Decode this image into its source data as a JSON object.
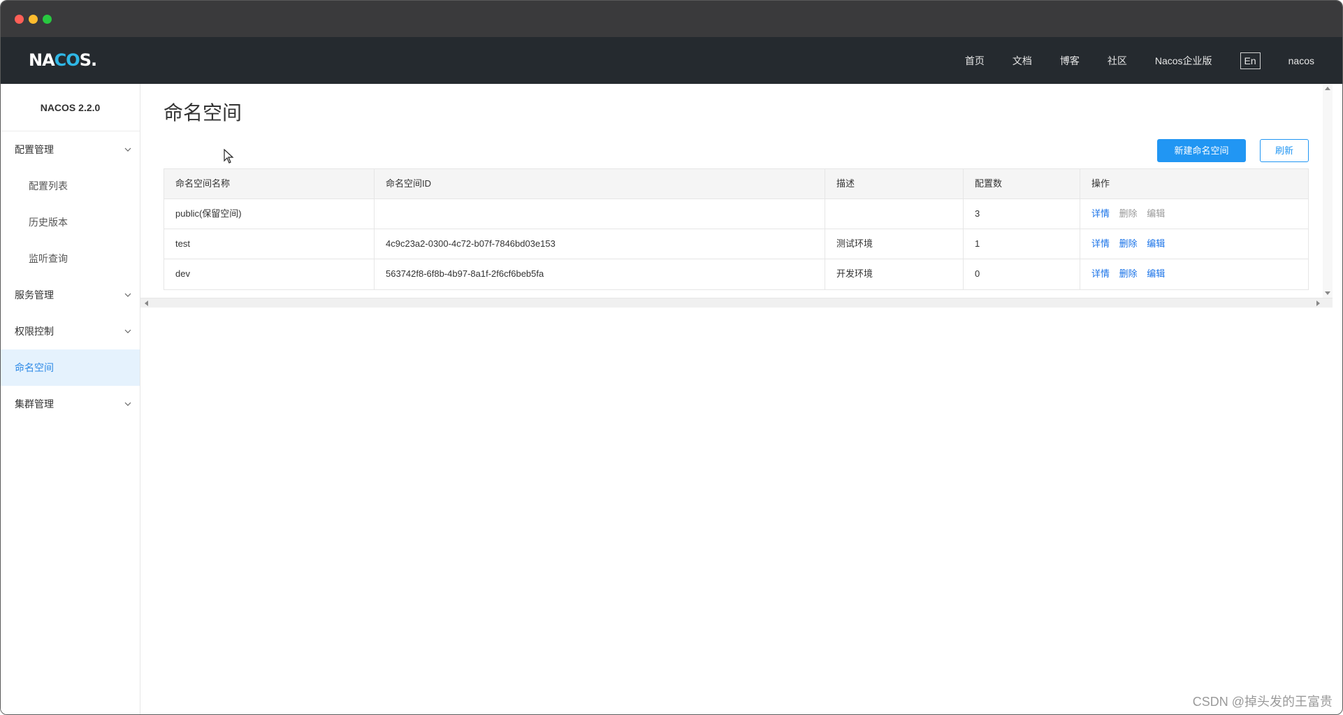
{
  "topnav": {
    "logo": "NACOS.",
    "links": [
      "首页",
      "文档",
      "博客",
      "社区",
      "Nacos企业版"
    ],
    "lang": "En",
    "user": "nacos"
  },
  "sidebar": {
    "title": "NACOS 2.2.0",
    "items": [
      {
        "label": "配置管理",
        "type": "group",
        "expanded": true
      },
      {
        "label": "配置列表",
        "type": "sub"
      },
      {
        "label": "历史版本",
        "type": "sub"
      },
      {
        "label": "监听查询",
        "type": "sub"
      },
      {
        "label": "服务管理",
        "type": "group"
      },
      {
        "label": "权限控制",
        "type": "group"
      },
      {
        "label": "命名空间",
        "type": "item",
        "active": true
      },
      {
        "label": "集群管理",
        "type": "group"
      }
    ]
  },
  "main": {
    "title": "命名空间",
    "new_button": "新建命名空间",
    "refresh_button": "刷新",
    "table": {
      "headers": [
        "命名空间名称",
        "命名空间ID",
        "描述",
        "配置数",
        "操作"
      ],
      "rows": [
        {
          "name": "public(保留空间)",
          "id": "",
          "desc": "",
          "count": "3",
          "actions": [
            "详情",
            "删除",
            "编辑"
          ],
          "editable": false
        },
        {
          "name": "test",
          "id": "4c9c23a2-0300-4c72-b07f-7846bd03e153",
          "desc": "测试环境",
          "count": "1",
          "actions": [
            "详情",
            "删除",
            "编辑"
          ],
          "editable": true
        },
        {
          "name": "dev",
          "id": "563742f8-6f8b-4b97-8a1f-2f6cf6beb5fa",
          "desc": "开发环境",
          "count": "0",
          "actions": [
            "详情",
            "删除",
            "编辑"
          ],
          "editable": true
        }
      ]
    }
  },
  "watermark": "CSDN @掉头发的王富贵",
  "colors": {
    "primary": "#2196f3",
    "nav_bg": "#252a2f",
    "active_bg": "#e5f2fd",
    "link": "#1a73e8"
  }
}
